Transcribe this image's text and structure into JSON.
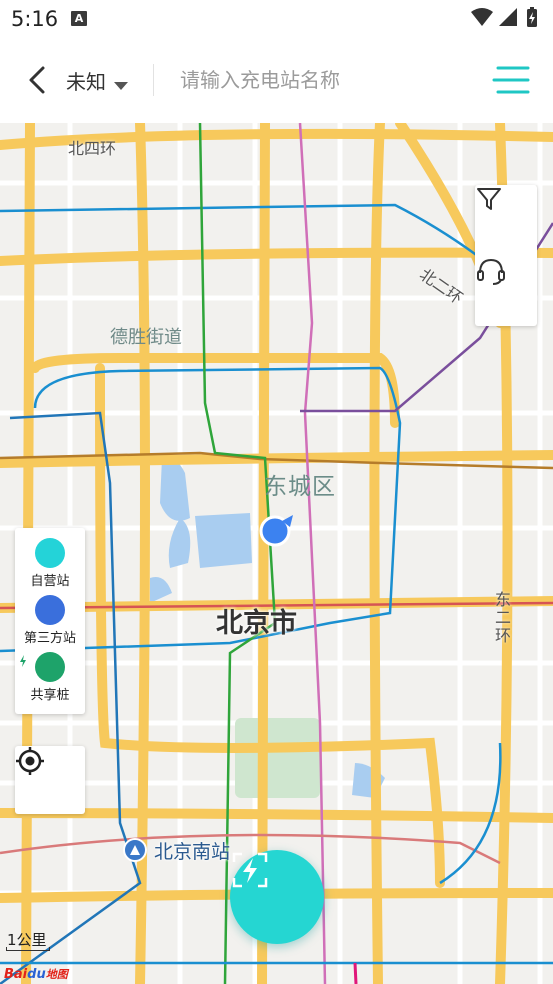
{
  "status_bar": {
    "time": "5:16",
    "notification_glyph": "A"
  },
  "header": {
    "city": "未知",
    "search_placeholder": "请输入充电站名称"
  },
  "map": {
    "labels": {
      "ring4_north": "北四环",
      "desheng": "德胜街道",
      "dongcheng": "东城区",
      "city": "北京市",
      "ring2_north": "北二环",
      "ring2_east": "东二环",
      "beijing_south": "北京南站"
    },
    "scale": "1公里",
    "logo": "Baidu地图"
  },
  "legend": {
    "items": [
      {
        "label": "自营站",
        "color": "#24d3d8"
      },
      {
        "label": "第三方站",
        "color": "#3a6fdc"
      },
      {
        "label": "共享桩",
        "color": "#1ea36a"
      }
    ]
  },
  "icons": {
    "back": "chevron-left-icon",
    "dropdown": "caret-down-icon",
    "menu": "list-menu-icon",
    "filter": "filter-icon",
    "service": "headset-icon",
    "locate": "locate-target-icon",
    "charge": "lightning-scan-icon"
  },
  "colors": {
    "accent": "#25d6d2",
    "third_party": "#3a6fdc",
    "shared": "#1ea36a"
  }
}
